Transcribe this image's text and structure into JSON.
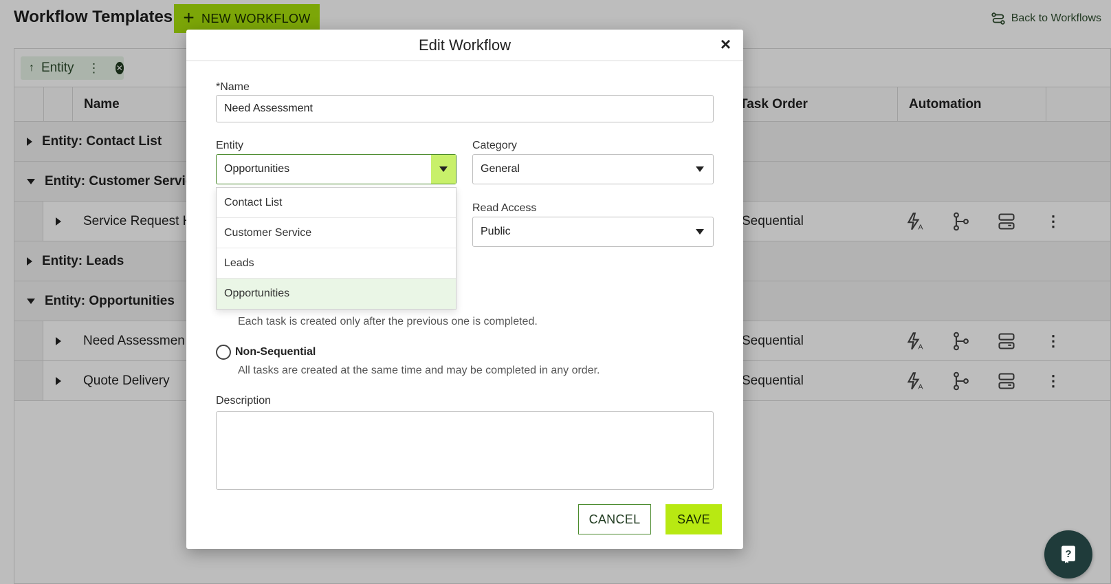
{
  "header": {
    "title": "Workflow Templates",
    "new_button": "NEW WORKFLOW",
    "back_link": "Back to Workflows"
  },
  "grid": {
    "group_chip": "Entity",
    "columns": {
      "name": "Name",
      "task_order": "Task Order",
      "automation": "Automation"
    },
    "groups": [
      {
        "label": "Entity: Contact List",
        "expanded": false
      },
      {
        "label": "Entity: Customer Service",
        "expanded": true,
        "items": [
          {
            "name": "Service Request H",
            "task_order": "Sequential"
          }
        ]
      },
      {
        "label": "Entity: Leads",
        "expanded": false
      },
      {
        "label": "Entity: Opportunities",
        "expanded": true,
        "items": [
          {
            "name": "Need Assessmen",
            "task_order": "Sequential"
          },
          {
            "name": "Quote Delivery",
            "task_order": "Sequential"
          }
        ]
      }
    ]
  },
  "modal": {
    "title": "Edit Workflow",
    "close_symbol": "×",
    "name_label": "*Name",
    "name_value": "Need Assessment",
    "entity_label": "Entity",
    "entity_value": "Opportunities",
    "entity_options": [
      "Contact List",
      "Customer Service",
      "Leads",
      "Opportunities"
    ],
    "entity_selected_index": 3,
    "category_label": "Category",
    "category_value": "General",
    "read_access_label": "Read Access",
    "read_access_value": "Public",
    "sequential_desc": "Each task is created only after the previous one is completed.",
    "non_sequential_label": "Non-Sequential",
    "non_sequential_desc": "All tasks are created at the same time and may be completed in any order.",
    "description_label": "Description",
    "description_value": "",
    "cancel_label": "CANCEL",
    "save_label": "SAVE"
  },
  "colors": {
    "accent": "#a8e10c",
    "save": "#b8e912",
    "dark_green": "#1f3b3a",
    "selected_option_bg": "#eaf6e6"
  },
  "icons": {
    "new_button": "plus-icon",
    "back_link": "workflow-icon",
    "automation_actions": [
      "auto-flash-icon",
      "branch-icon",
      "template-icon"
    ],
    "row_menu": "more-vertical-icon",
    "help": "help-book-icon"
  }
}
